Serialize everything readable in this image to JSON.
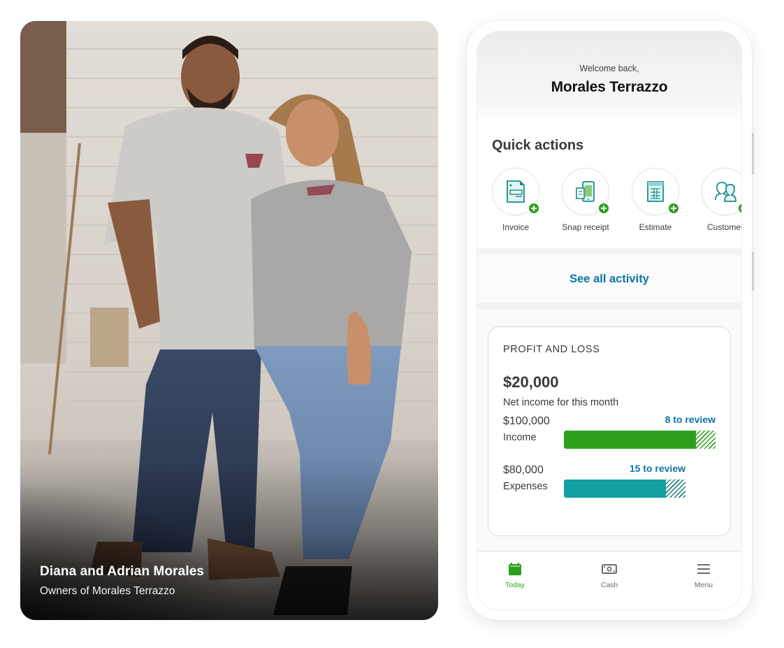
{
  "testimonial": {
    "name": "Diana and Adrian Morales",
    "role": "Owners of Morales Terrazzo",
    "image_description": "Photo of two smiling business owners in matching grey polo shirts standing in a workshop"
  },
  "app": {
    "header": {
      "welcome": "Welcome back,",
      "company": "Morales Terrazzo"
    },
    "quick_actions": {
      "title": "Quick actions",
      "items": [
        {
          "label": "Invoice",
          "icon": "invoice-icon"
        },
        {
          "label": "Snap receipt",
          "icon": "receipt-icon"
        },
        {
          "label": "Estimate",
          "icon": "estimate-icon"
        },
        {
          "label": "Customer",
          "icon": "customer-icon"
        }
      ]
    },
    "see_all_activity": "See all activity",
    "profit_and_loss": {
      "title": "PROFIT AND LOSS",
      "net_income": "$20,000",
      "net_income_label": "Net income for this month",
      "income": {
        "amount": "$100,000",
        "label": "Income",
        "review": "8 to review",
        "reviewed_fraction": 0.87
      },
      "expenses": {
        "amount": "$80,000",
        "label": "Expenses",
        "review": "15 to review",
        "reviewed_fraction": 0.84
      }
    },
    "tabs": [
      {
        "label": "Today",
        "icon": "calendar-icon",
        "active": true
      },
      {
        "label": "Cash",
        "icon": "cash-icon",
        "active": false
      },
      {
        "label": "Menu",
        "icon": "menu-icon",
        "active": false
      }
    ]
  },
  "colors": {
    "brand_green": "#2ca01c",
    "expense_teal": "#12a0a0",
    "link_blue": "#0d74a6",
    "text_dark": "#393a3d"
  }
}
